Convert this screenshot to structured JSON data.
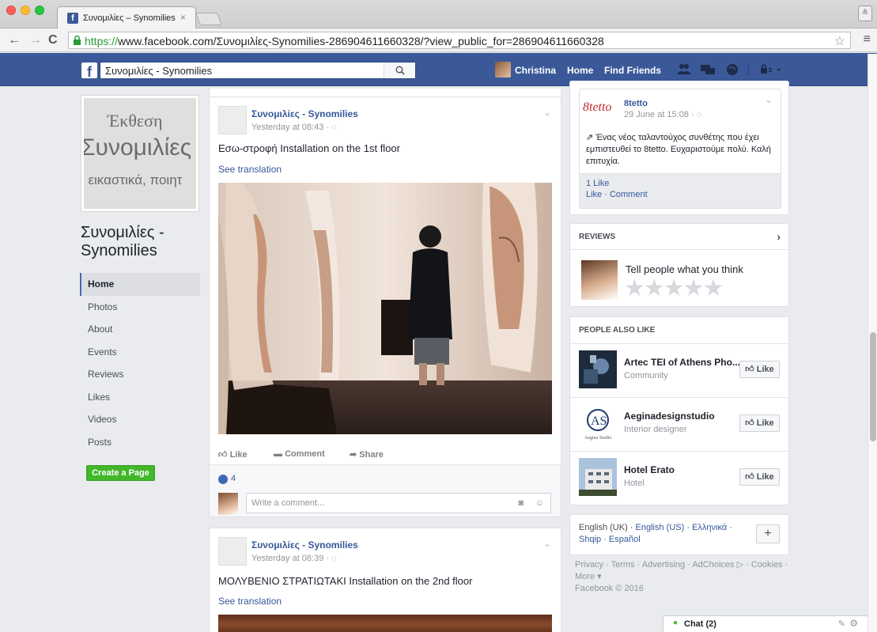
{
  "browser": {
    "tab_title": "Συνομιλίες – Synomilies",
    "url_https": "https://",
    "url_rest": "www.facebook.com/Συνομιλίες-Synomilies-286904611660328/?view_public_for=286904611660328"
  },
  "topbar": {
    "search_value": "Συνομιλίες - Synomilies",
    "user_name": "Christina",
    "home_label": "Home",
    "find_friends_label": "Find Friends"
  },
  "page": {
    "cover_line1": "Έκθεση",
    "cover_line2": "Συνομιλίες",
    "cover_line3": ", εικαστικά, ποιητ",
    "name": "Συνομιλίες - Synomilies",
    "nav": [
      {
        "label": "Home",
        "active": true
      },
      {
        "label": "Photos"
      },
      {
        "label": "About"
      },
      {
        "label": "Events"
      },
      {
        "label": "Reviews"
      },
      {
        "label": "Likes"
      },
      {
        "label": "Videos"
      },
      {
        "label": "Posts"
      }
    ],
    "create_page_label": "Create a Page"
  },
  "posts": [
    {
      "author": "Συνομιλίες - Synomilies",
      "time": "Yesterday at 08:43 · ",
      "text": "Εσω-στροφή Installation on the 1st floor",
      "see_translation": "See translation",
      "actions": {
        "like": "Like",
        "comment": "Comment",
        "share": "Share"
      },
      "likes": "4",
      "comment_placeholder": "Write a comment..."
    },
    {
      "author": "Συνομιλίες - Synomilies",
      "time": "Yesterday at 08:39 · ",
      "text": "ΜΟΛΥΒΕΝΙΟ ΣΤΡΑΤΙΩΤΑΚΙ Installation on the 2nd floor",
      "see_translation": "See translation"
    }
  ],
  "mini_post": {
    "author": "8tetto",
    "time": "29 June at 15:08 · ",
    "text": "Ένας νέος ταλαντούχος συνθέτης που έχει εμπιστευθεί το 8tetto. Ευχαριστούμε πολύ. Καλή επιτυχία.",
    "likes": "1 Like",
    "actions": "Like · Comment"
  },
  "reviews": {
    "header": "REVIEWS",
    "prompt": "Tell people what you think",
    "stars": "★★★★★"
  },
  "people_also_like": {
    "header": "PEOPLE ALSO LIKE",
    "items": [
      {
        "name": "Artec TEI of Athens Pho...",
        "category": "Community",
        "like": "Like"
      },
      {
        "name": "Aeginadesignstudio",
        "category": "Interior designer",
        "like": "Like"
      },
      {
        "name": "Hotel Erato",
        "category": "Hotel",
        "like": "Like"
      }
    ]
  },
  "languages": {
    "current": "English (UK) · ",
    "others": [
      "English (US)",
      "Ελληνικά",
      "Shqip",
      "Español"
    ],
    "plus": "+"
  },
  "footer": {
    "line1": "Privacy · Terms · Advertising · AdChoices ▷ · Cookies ·",
    "line2": "More ▾",
    "copyright": "Facebook © 2016"
  },
  "chat": {
    "label": "Chat (2)"
  }
}
